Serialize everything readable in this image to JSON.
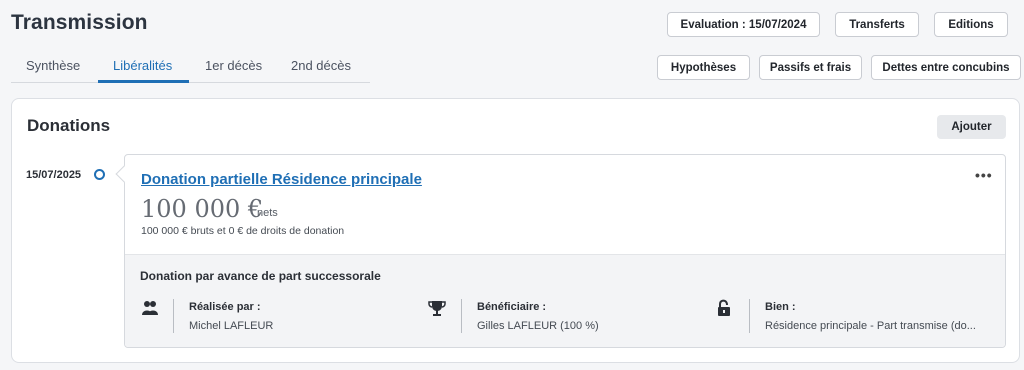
{
  "header": {
    "title": "Transmission",
    "buttons": {
      "evaluation": "Evaluation : 15/07/2024",
      "transferts": "Transferts",
      "editions": "Editions",
      "hypotheses": "Hypothèses",
      "passifs": "Passifs et frais",
      "dettes": "Dettes entre concubins"
    }
  },
  "tabs": [
    {
      "label": "Synthèse",
      "active": false
    },
    {
      "label": "Libéralités",
      "active": true
    },
    {
      "label": "1er décès",
      "active": false
    },
    {
      "label": "2nd décès",
      "active": false
    }
  ],
  "donations": {
    "title": "Donations",
    "add_label": "Ajouter",
    "item": {
      "date": "15/07/2025",
      "title": "Donation partielle Résidence principale",
      "amount": "100 000 €",
      "amount_suffix": "nets",
      "detail": "100 000 € bruts et 0 € de droits de donation",
      "more": "•••",
      "type": "Donation par avance de part successorale",
      "fields": {
        "realisee_label": "Réalisée par :",
        "realisee_value": "Michel LAFLEUR",
        "beneficiaire_label": "Bénéficiaire :",
        "beneficiaire_value": "Gilles LAFLEUR (100 %)",
        "bien_label": "Bien :",
        "bien_value": "Résidence principale - Part transmise (do..."
      }
    }
  },
  "icons": {
    "people": "people-icon",
    "trophy": "trophy-icon",
    "lock": "unlock-icon"
  },
  "colors": {
    "accent": "#1f6fb5",
    "text": "#2b2f36"
  }
}
